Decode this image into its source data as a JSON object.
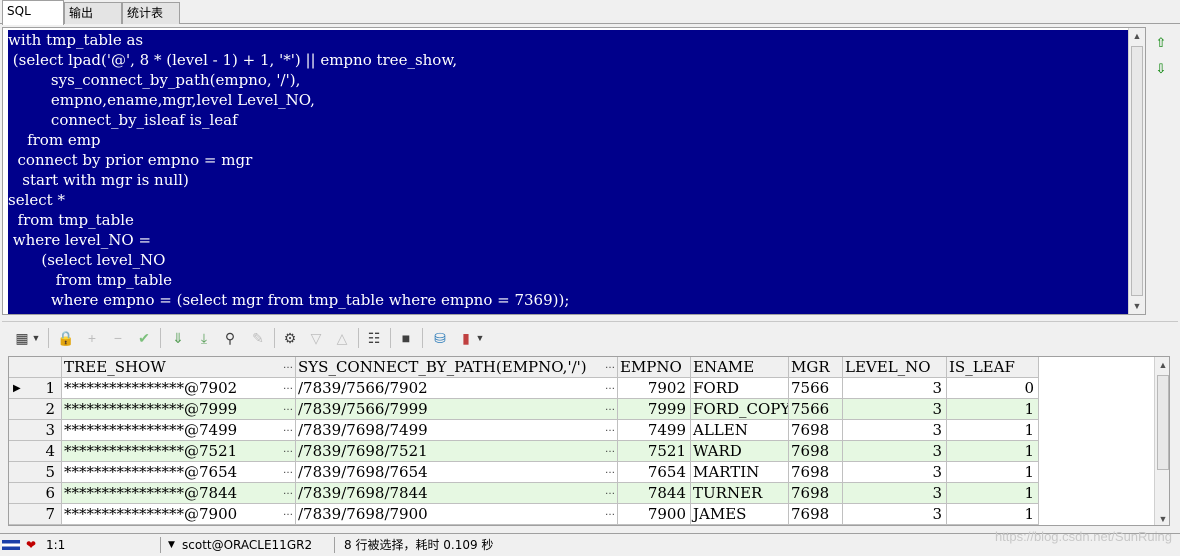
{
  "tabs": [
    {
      "label": "SQL"
    },
    {
      "label": "输出"
    },
    {
      "label": "统计表"
    }
  ],
  "editor": {
    "lines": [
      "with tmp_table as",
      " (select lpad('@', 8 * (level - 1) + 1, '*') || empno tree_show,",
      "         sys_connect_by_path(empno, '/'),",
      "         empno,ename,mgr,level Level_NO,",
      "         connect_by_isleaf is_leaf",
      "    from emp",
      "  connect by prior empno = mgr",
      "   start with mgr is null)",
      "select *",
      "  from tmp_table",
      " where level_NO =",
      "       (select level_NO",
      "          from tmp_table",
      "         where empno = (select mgr from tmp_table where empno = 7369));"
    ]
  },
  "grid": {
    "columns": [
      "TREE_SHOW",
      "SYS_CONNECT_BY_PATH(EMPNO,'/')",
      "EMPNO",
      "ENAME",
      "MGR",
      "LEVEL_NO",
      "IS_LEAF"
    ],
    "rows": [
      {
        "n": "1",
        "tree_show": "****************@7902",
        "path": "/7839/7566/7902",
        "empno": "7902",
        "ename": "FORD",
        "mgr": "7566",
        "level_no": "3",
        "is_leaf": "0"
      },
      {
        "n": "2",
        "tree_show": "****************@7999",
        "path": "/7839/7566/7999",
        "empno": "7999",
        "ename": "FORD_COPY",
        "mgr": "7566",
        "level_no": "3",
        "is_leaf": "1"
      },
      {
        "n": "3",
        "tree_show": "****************@7499",
        "path": "/7839/7698/7499",
        "empno": "7499",
        "ename": "ALLEN",
        "mgr": "7698",
        "level_no": "3",
        "is_leaf": "1"
      },
      {
        "n": "4",
        "tree_show": "****************@7521",
        "path": "/7839/7698/7521",
        "empno": "7521",
        "ename": "WARD",
        "mgr": "7698",
        "level_no": "3",
        "is_leaf": "1"
      },
      {
        "n": "5",
        "tree_show": "****************@7654",
        "path": "/7839/7698/7654",
        "empno": "7654",
        "ename": "MARTIN",
        "mgr": "7698",
        "level_no": "3",
        "is_leaf": "1"
      },
      {
        "n": "6",
        "tree_show": "****************@7844",
        "path": "/7839/7698/7844",
        "empno": "7844",
        "ename": "TURNER",
        "mgr": "7698",
        "level_no": "3",
        "is_leaf": "1"
      },
      {
        "n": "7",
        "tree_show": "****************@7900",
        "path": "/7839/7698/7900",
        "empno": "7900",
        "ename": "JAMES",
        "mgr": "7698",
        "level_no": "3",
        "is_leaf": "1"
      }
    ]
  },
  "status": {
    "position": "1:1",
    "connection": "scott@ORACLE11GR2",
    "message": "8 行被选择，耗时 0.109 秒"
  },
  "watermark": "https://blog.csdn.net/SunRuing",
  "colors": {
    "selection_bg": "#00008b",
    "alt_row": "#e6f8e2"
  }
}
